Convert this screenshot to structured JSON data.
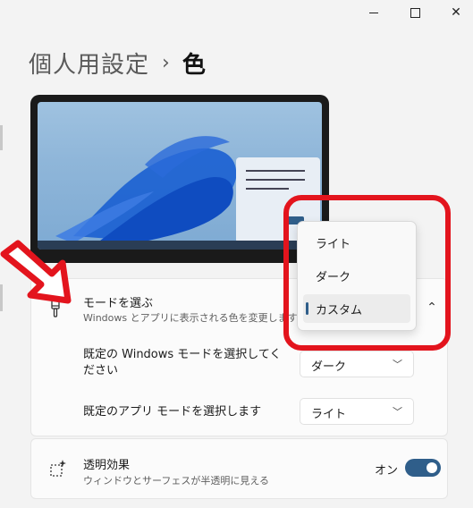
{
  "window": {
    "minimize": "minimize",
    "maximize": "maximize",
    "close": "close"
  },
  "breadcrumb": {
    "parent": "個人用設定",
    "separator": "›",
    "current": "色"
  },
  "mode": {
    "title": "モードを選ぶ",
    "description": "Windows とアプリに表示される色を変更します",
    "expanded": true
  },
  "mode_dropdown": {
    "items": [
      "ライト",
      "ダーク",
      "カスタム"
    ],
    "selected": "カスタム"
  },
  "windows_mode": {
    "label": "既定の Windows モードを選択してください",
    "value": "ダーク"
  },
  "app_mode": {
    "label": "既定のアプリ モードを選択します",
    "value": "ライト"
  },
  "transparency": {
    "title": "透明効果",
    "description": "ウィンドウとサーフェスが半透明に見える",
    "state_label": "オン",
    "on": true
  },
  "colors": {
    "accent": "#2f5e8a",
    "highlight": "#e3141d"
  }
}
